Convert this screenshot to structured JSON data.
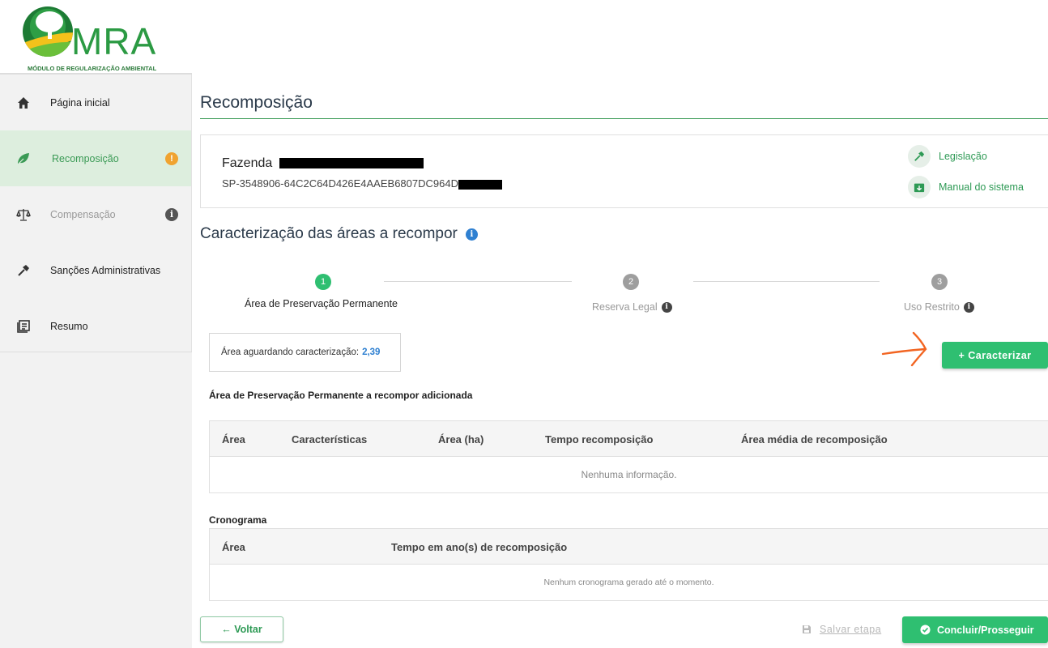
{
  "logo": {
    "text": "MRA",
    "subtitle": "MÓDULO DE REGULARIZAÇÃO AMBIENTAL"
  },
  "sidebar": {
    "items": [
      {
        "label": "Página inicial",
        "icon": "home-icon"
      },
      {
        "label": "Recomposição",
        "icon": "leaf-icon",
        "badge": "!",
        "badge_color": "#f0a330"
      },
      {
        "label": "Compensação",
        "icon": "scale-icon",
        "badge": "i",
        "badge_color": "#555555"
      },
      {
        "label": "Sanções Administrativas",
        "icon": "hammer-icon"
      },
      {
        "label": "Resumo",
        "icon": "book-icon"
      }
    ]
  },
  "page": {
    "title": "Recomposição"
  },
  "farm": {
    "name": "Fazenda",
    "code": "SP-3548906-64C2C64D426E4AAEB6807DC964D"
  },
  "help": {
    "legislacao": "Legislação",
    "manual": "Manual do sistema"
  },
  "section": {
    "title": "Caracterização das áreas a recompor"
  },
  "stepper": {
    "current_step": 1,
    "steps": [
      {
        "number": "1",
        "label": "Área de Preservação Permanente"
      },
      {
        "number": "2",
        "label": "Reserva Legal"
      },
      {
        "number": "3",
        "label": "Uso Restrito"
      }
    ]
  },
  "pending": {
    "label": "Área aguardando caracterização:",
    "value": "2,39"
  },
  "buttons": {
    "caracterizar": "+ Caracterizar",
    "voltar": "← Voltar",
    "salvar": "Salvar etapa",
    "concluir": "Concluir/Prosseguir"
  },
  "app_table": {
    "title": "Área de Preservação Permanente a recompor adicionada",
    "columns": [
      "Área",
      "Características",
      "Área (ha)",
      "Tempo recomposição",
      "Área média de recomposição"
    ],
    "empty": "Nenhuma informação."
  },
  "cronograma": {
    "title": "Cronograma",
    "columns": [
      "Área",
      "Tempo em ano(s) de recomposição"
    ],
    "empty": "Nenhum cronograma gerado até o momento."
  },
  "colors": {
    "primary_green": "#2fbf71",
    "step_active": "#2fbf71",
    "step_inactive": "#9e9e9e",
    "info_blue": "#2f80d1",
    "annotation_arrow": "#f26522"
  }
}
